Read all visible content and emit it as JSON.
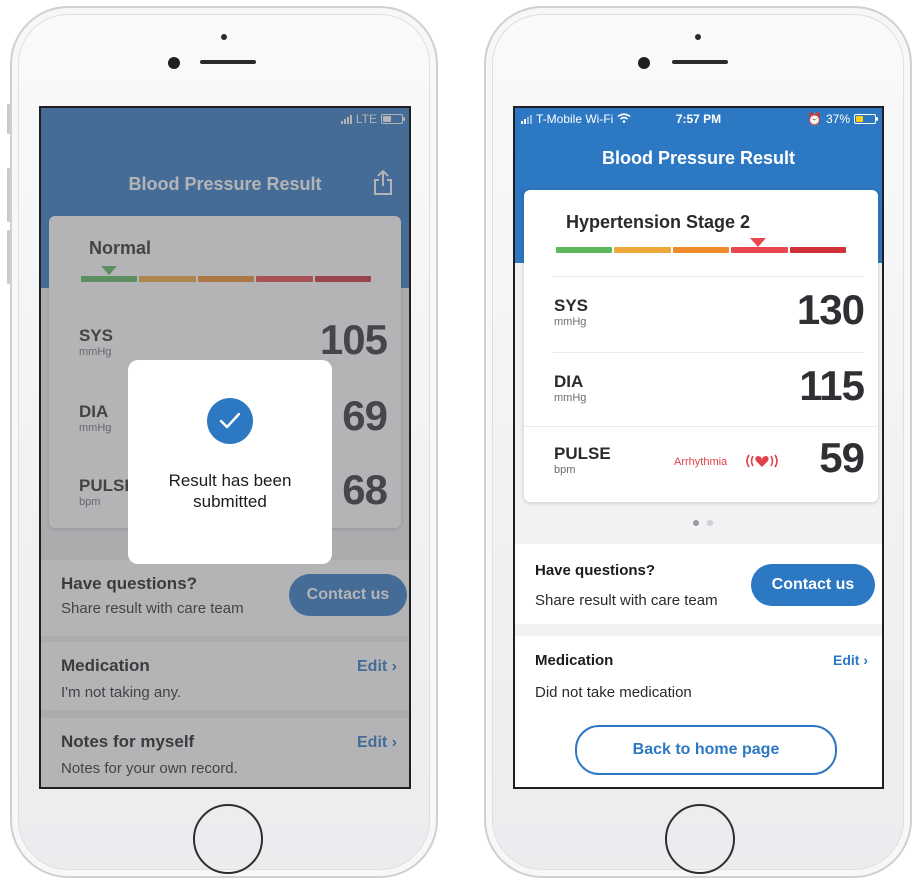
{
  "colors": {
    "primary": "#2d78c2",
    "scale": [
      "#5cb85c",
      "#f0a83a",
      "#f08a2b",
      "#e8474f",
      "#cf2f36"
    ],
    "arrhythmia": "#e0424b"
  },
  "left_phone": {
    "status": {
      "network": "LTE"
    },
    "header": {
      "title": "Blood Pressure Result",
      "share_icon": "share-icon"
    },
    "card": {
      "stage": "Normal",
      "stage_index": 0,
      "metrics": [
        {
          "name": "SYS",
          "unit": "mmHg",
          "value": "105"
        },
        {
          "name": "DIA",
          "unit": "mmHg",
          "value": "69"
        },
        {
          "name": "PULSE",
          "unit": "bpm",
          "value": "68"
        }
      ]
    },
    "modal": {
      "icon": "check-icon",
      "message": "Result has been submitted"
    },
    "questions": {
      "title": "Have questions?",
      "subtitle": "Share result with care team",
      "button": "Contact us"
    },
    "medication": {
      "title": "Medication",
      "subtitle": "I'm not taking any.",
      "edit": "Edit"
    },
    "notes": {
      "title": "Notes for myself",
      "subtitle": "Notes for your own record.",
      "edit": "Edit"
    }
  },
  "right_phone": {
    "status": {
      "carrier": "T-Mobile Wi-Fi",
      "time": "7:57 PM",
      "battery": "37%",
      "battery_level": 0.37
    },
    "header": {
      "title": "Blood Pressure Result"
    },
    "card": {
      "stage": "Hypertension Stage 2",
      "stage_index": 3,
      "metrics": [
        {
          "name": "SYS",
          "unit": "mmHg",
          "value": "130"
        },
        {
          "name": "DIA",
          "unit": "mmHg",
          "value": "115"
        },
        {
          "name": "PULSE",
          "unit": "bpm",
          "value": "59",
          "flag": "Arrhythmia"
        }
      ]
    },
    "pager": {
      "count": 2,
      "active": 0
    },
    "questions": {
      "title": "Have questions?",
      "subtitle": "Share result with care team",
      "button": "Contact us"
    },
    "medication": {
      "title": "Medication",
      "subtitle": "Did not take medication",
      "edit": "Edit"
    },
    "home_button": "Back to home page"
  }
}
